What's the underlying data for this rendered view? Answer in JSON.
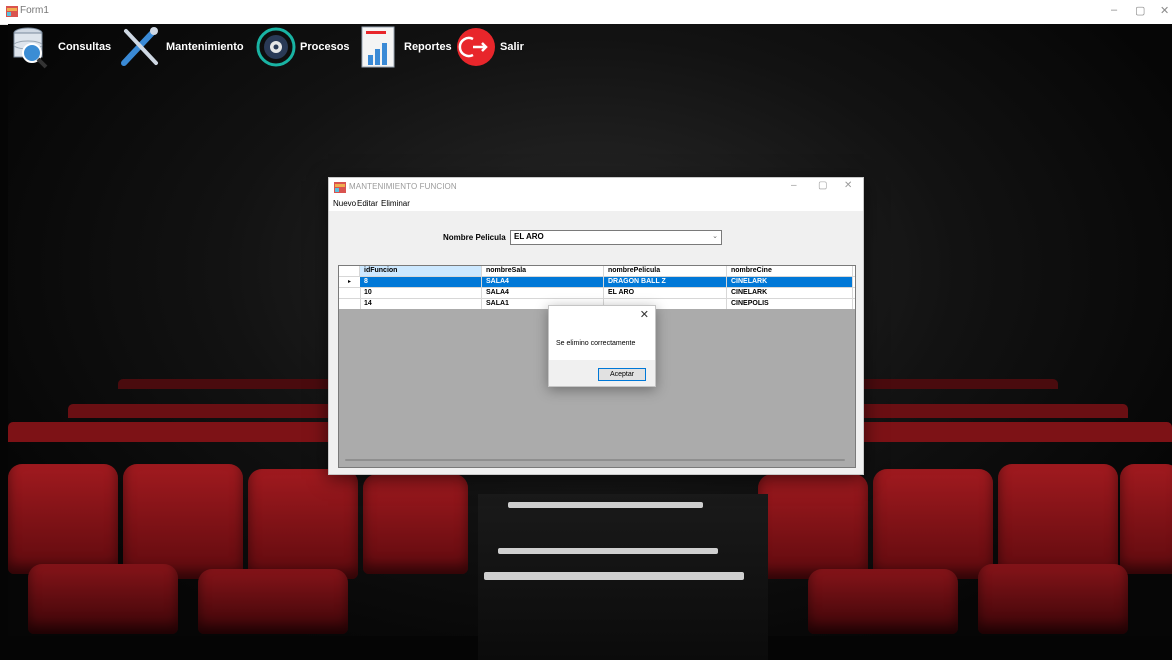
{
  "form1": {
    "title": "Form1",
    "controls": [
      "–",
      "▢",
      "✕"
    ]
  },
  "menu": [
    {
      "label": "Consultas",
      "icon": "database-search-icon"
    },
    {
      "label": "Mantenimiento",
      "icon": "tools-icon"
    },
    {
      "label": "Procesos",
      "icon": "gear-sync-icon"
    },
    {
      "label": "Reportes",
      "icon": "report-chart-icon"
    },
    {
      "label": "Salir",
      "icon": "exit-icon"
    }
  ],
  "child_window": {
    "title": "MANTENIMIENTO FUNCION",
    "controls": [
      "–",
      "▢",
      "✕"
    ],
    "menu": [
      "Nuevo",
      "Editar",
      "Eliminar"
    ],
    "filter_label": "Nombre Pelicula",
    "filter_value": "EL ARO",
    "grid": {
      "columns": [
        "idFuncion",
        "nombreSala",
        "nombrePelicula",
        "nombreCine"
      ],
      "rows": [
        {
          "indicator": "▸",
          "cells": [
            "8",
            "SALA4",
            "DRAGON BALL Z",
            "CINELARK"
          ],
          "selected": true
        },
        {
          "indicator": "",
          "cells": [
            "10",
            "SALA4",
            "EL ARO",
            "CINELARK"
          ],
          "selected": false
        },
        {
          "indicator": "",
          "cells": [
            "14",
            "SALA1",
            "",
            "CINEPOLIS"
          ],
          "selected": false
        }
      ]
    }
  },
  "message_box": {
    "text": "Se elimino correctamente",
    "button": "Aceptar",
    "close": "✕"
  },
  "colors": {
    "selection": "#0078d7",
    "seat_red": "#a11a1f",
    "exit_red": "#e8262b"
  }
}
